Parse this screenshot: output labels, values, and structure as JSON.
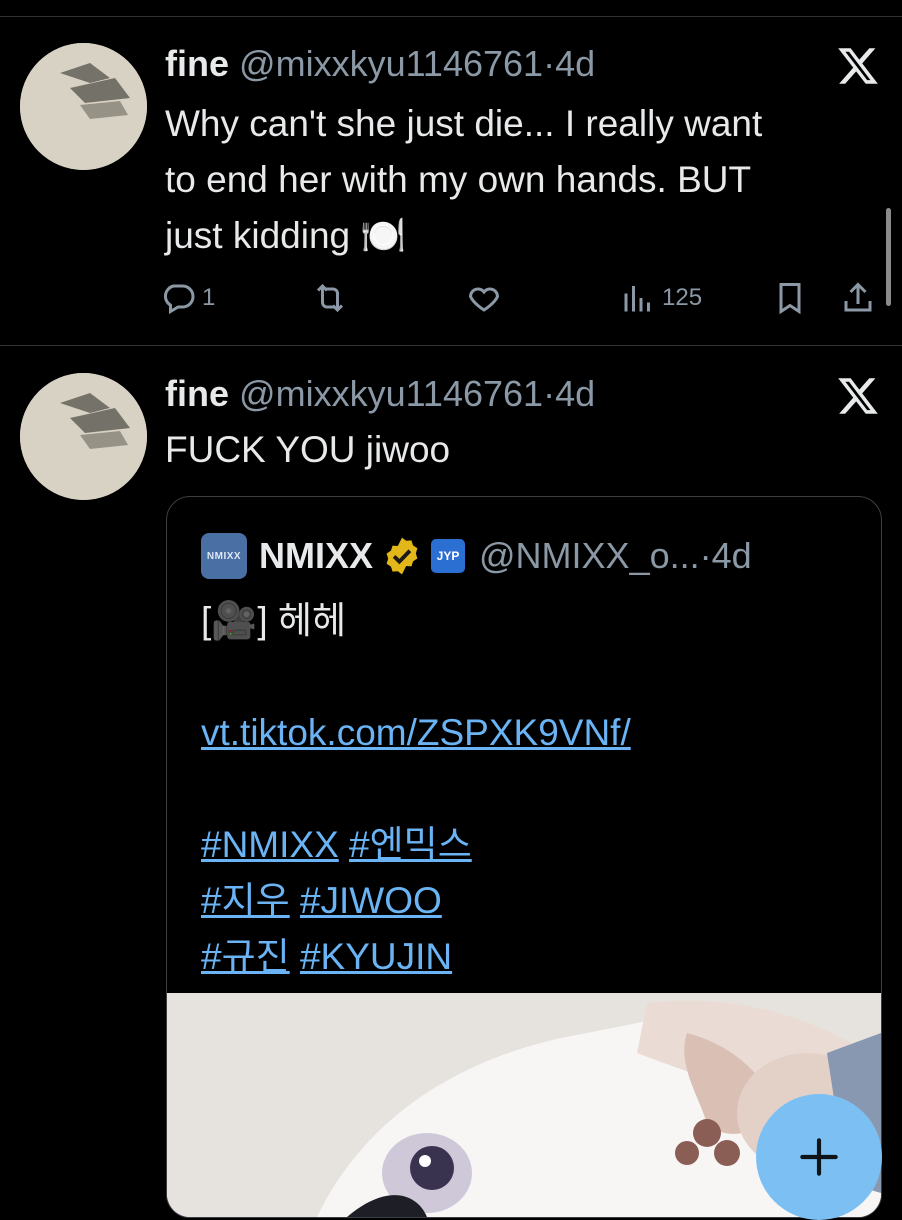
{
  "tweets": [
    {
      "name": "fine",
      "handle": "@mixxkyu1146761",
      "separator": "·",
      "time": "4d",
      "text_lines": [
        "Why can't she just die... I really want",
        "to end her with my own hands. BUT",
        "just kidding 🍽️"
      ],
      "actions": {
        "replies": "1",
        "reposts": "",
        "likes": "",
        "views": "125"
      }
    },
    {
      "name": "fine",
      "handle": "@mixxkyu1146761",
      "separator": "·",
      "time": "4d",
      "text": "FUCK YOU jiwoo",
      "quote": {
        "avatar_label": "NMIXX",
        "name": "NMIXX",
        "affiliation_badge": "JYP",
        "handle": "@NMIXX_o...",
        "separator": "·",
        "time": "4d",
        "text": "[🎥] 헤헤",
        "link": "vt.tiktok.com/ZSPXK9VNf/",
        "hashtags": [
          [
            "#NMIXX",
            "#엔믹스"
          ],
          [
            "#지우",
            "#JIWOO"
          ],
          [
            "#규진",
            "#KYUJIN"
          ]
        ]
      }
    }
  ],
  "icons": {
    "more": "x-logo-icon",
    "reply": "reply-icon",
    "repost": "repost-icon",
    "like": "heart-icon",
    "views": "views-icon",
    "bookmark": "bookmark-icon",
    "share": "share-icon",
    "compose": "plus-icon"
  },
  "colors": {
    "background": "#000000",
    "link": "#6ab4f5",
    "muted": "#8b98a5",
    "fab": "#7cc0f3",
    "verified": "#e2b719"
  }
}
